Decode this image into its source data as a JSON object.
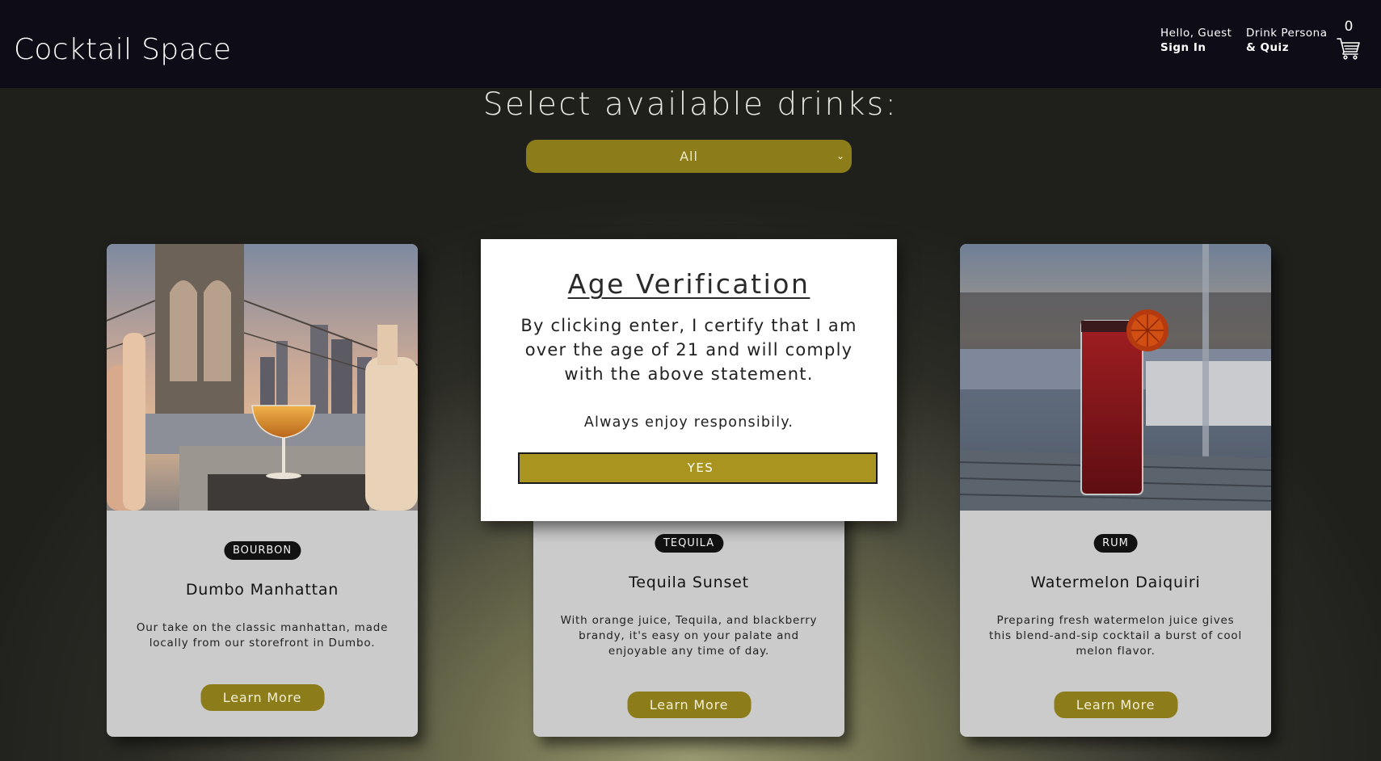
{
  "header": {
    "brand": "Cocktail Space",
    "account": {
      "greeting": "Hello, Guest",
      "action": "Sign In"
    },
    "persona": {
      "line1": "Drink Persona",
      "line2": "& Quiz"
    },
    "cart": {
      "count": "0",
      "icon": "cart-icon"
    }
  },
  "filter": {
    "title": "Select available drinks:",
    "selected": "All",
    "icon": "chevron-down-icon"
  },
  "cards": [
    {
      "category": "BOURBON",
      "name": "Dumbo Manhattan",
      "description": "Our take on the classic manhattan, made locally from our storefront in Dumbo.",
      "button": "Learn More"
    },
    {
      "category": "TEQUILA",
      "name": "Tequila Sunset",
      "description": "With orange juice, Tequila, and blackberry brandy, it's easy on your palate and enjoyable any time of day.",
      "button": "Learn More"
    },
    {
      "category": "RUM",
      "name": "Watermelon Daiquiri",
      "description": "Preparing fresh watermelon juice gives this blend-and-sip cocktail a burst of cool melon flavor.",
      "button": "Learn More"
    }
  ],
  "modal": {
    "title": "Age Verification",
    "text": "By clicking enter, I certify that I am over the age of 21 and will comply with the above statement.",
    "note": "Always enjoy responsibily.",
    "confirm": "YES"
  },
  "colors": {
    "header_bg": "#0e0c16",
    "accent": "#8c7d1a",
    "modal_button": "#a8941f",
    "card_bg": "#cbcbcb",
    "badge_bg": "#121212"
  }
}
